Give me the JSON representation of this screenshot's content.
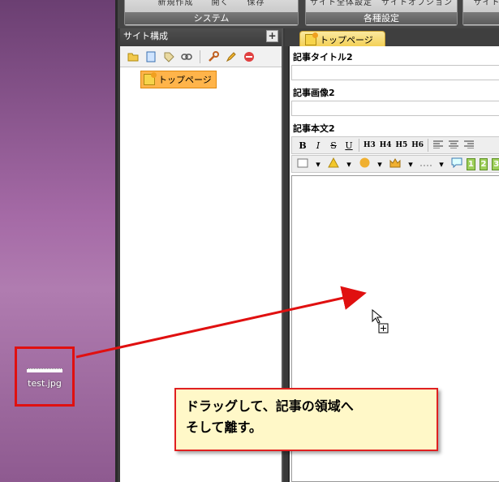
{
  "ribbon": {
    "groups": [
      {
        "partial": "新規作成　　開く　　保存",
        "label": "システム"
      },
      {
        "partial": "サイト全体設定　サイトオプション",
        "label": "各種設定"
      },
      {
        "partial": "サイト",
        "label": ""
      }
    ]
  },
  "site_panel": {
    "title": "サイト構成",
    "add_button": "+",
    "tree": [
      {
        "label": "トップページ"
      }
    ]
  },
  "editor": {
    "tab_label": "トップページ",
    "fields": [
      {
        "label": "記事タイトル2"
      },
      {
        "label": "記事画像2"
      },
      {
        "label": "記事本文2"
      }
    ],
    "format_buttons": [
      "B",
      "I",
      "S",
      "U",
      "H3",
      "H4",
      "H5",
      "H6"
    ],
    "number_buttons": [
      "1",
      "2",
      "3"
    ]
  },
  "desktop": {
    "file_name": "test.jpg"
  },
  "callout": {
    "line1": "ドラッグして、記事の領域へ",
    "line2": "そして離す。"
  },
  "colors": {
    "highlight_red": "#e01010",
    "tab_yellow": "#f3cf52",
    "tree_selected": "#ffb44a",
    "callout_bg": "#fff8c8"
  }
}
